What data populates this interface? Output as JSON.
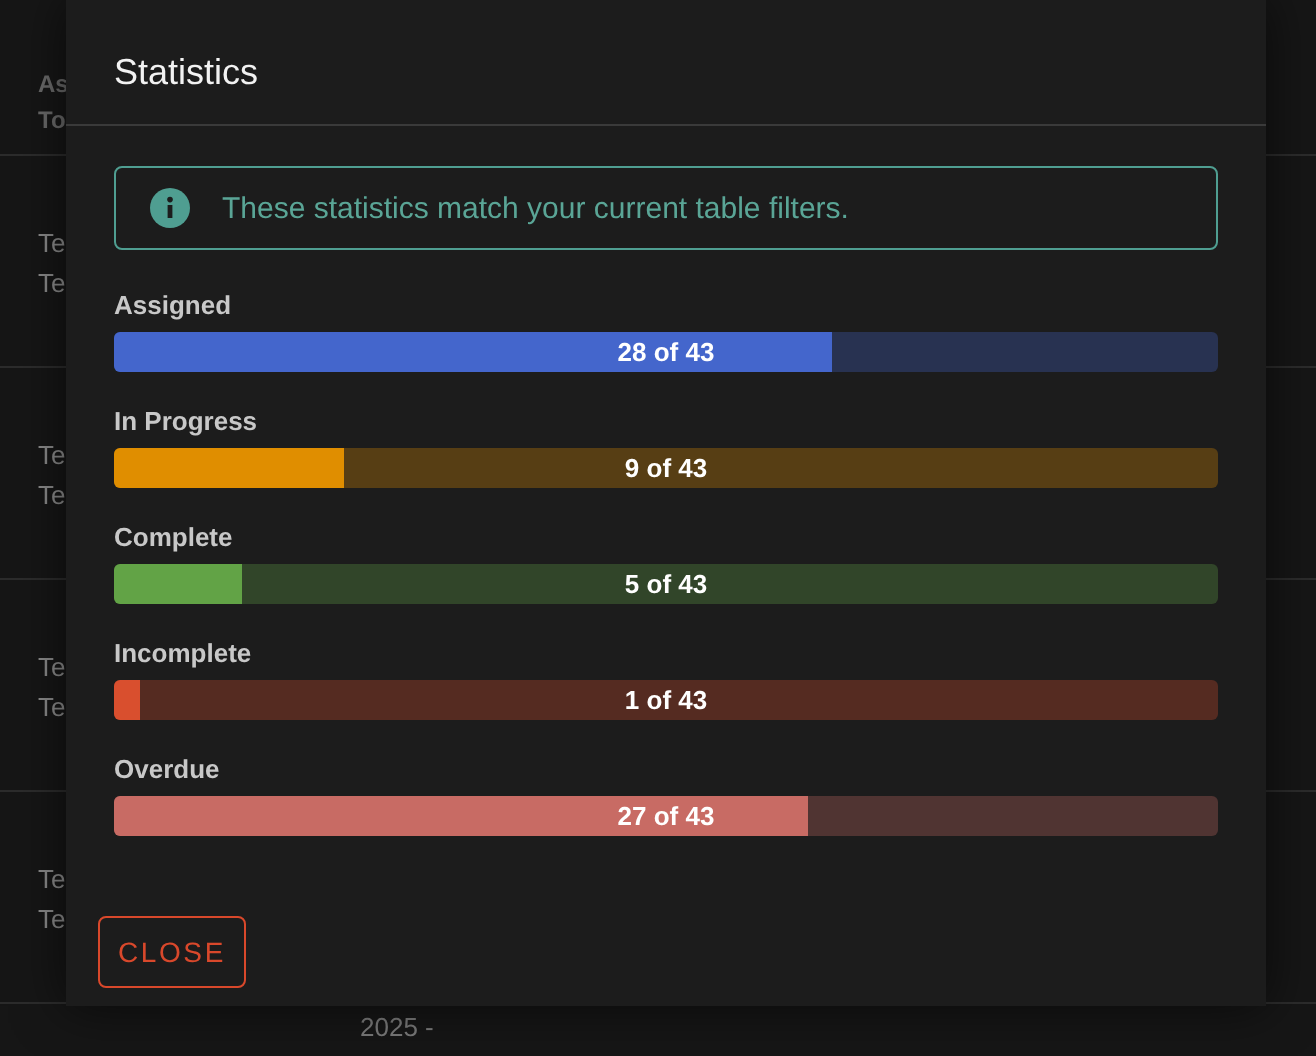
{
  "background_table": {
    "header": [
      "As",
      "To"
    ],
    "rows": [
      [
        "Te",
        "Te"
      ],
      [
        "Te",
        "Te"
      ],
      [
        "Te",
        "Te"
      ],
      [
        "Te",
        "Te"
      ]
    ],
    "footer": "2025 -"
  },
  "dialog": {
    "title": "Statistics",
    "notice": "These statistics match your current table filters.",
    "stats": [
      {
        "label": "Assigned",
        "reading": "28 of 43",
        "level": 0.651,
        "color": "#4466cc"
      },
      {
        "label": "In Progress",
        "reading": "9 of 43",
        "level": 0.209,
        "color": "#e08e00"
      },
      {
        "label": "Complete",
        "reading": "5 of 43",
        "level": 0.116,
        "color": "#62a346"
      },
      {
        "label": "Incomplete",
        "reading": "1 of 43",
        "level": 0.023,
        "color": "#d94f2e"
      },
      {
        "label": "Overdue",
        "reading": "27 of 43",
        "level": 0.628,
        "color": "#c86b64"
      }
    ],
    "buttons": [
      "CLOSE"
    ]
  }
}
